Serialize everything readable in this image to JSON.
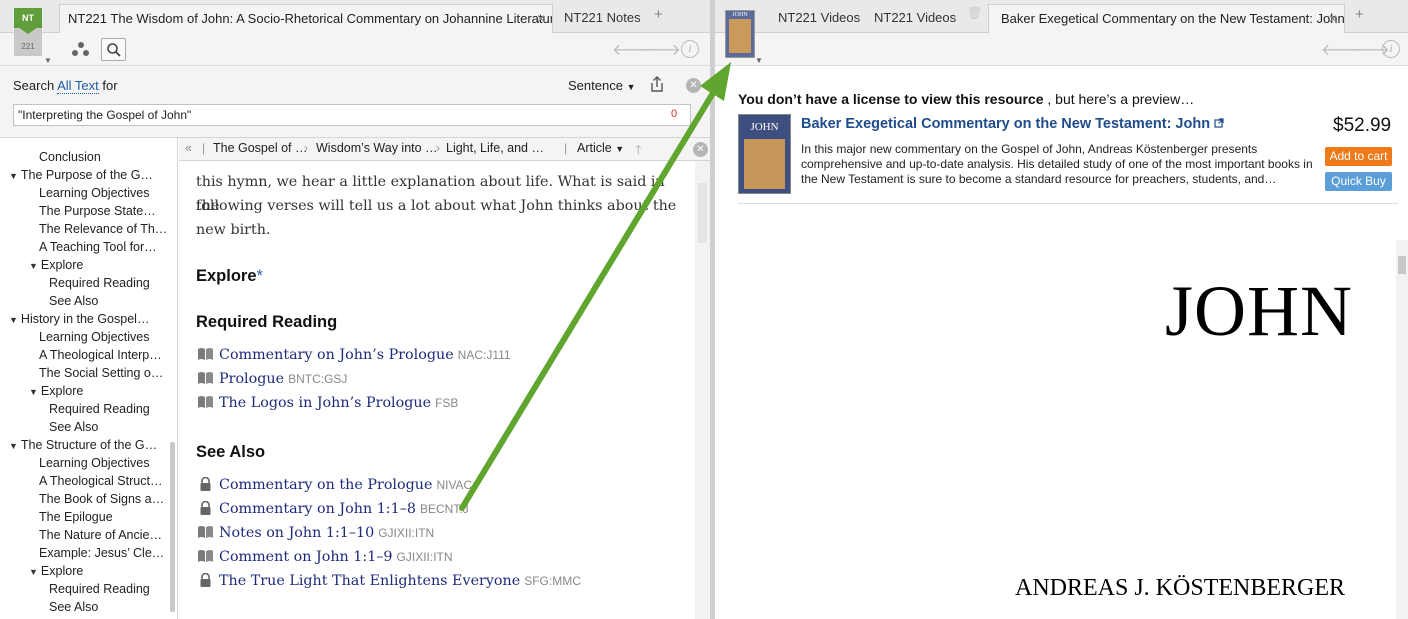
{
  "left": {
    "tabs": [
      {
        "label": "NT221 The Wisdom of John: A Socio-Rhetorical Commentary on Johannine Literature",
        "active": true
      },
      {
        "label": "NT221 Notes",
        "active": false
      }
    ],
    "logo": {
      "top": "NT",
      "bottom": "221"
    },
    "search": {
      "prefix": "Search",
      "scope": "All Text",
      "suffix": "for",
      "mode": "Sentence",
      "query": "\"Interpreting the Gospel of John\"",
      "count": "0"
    },
    "outline": [
      {
        "label": "Conclusion",
        "level": 2,
        "twisty": false
      },
      {
        "label": "The Purpose of the G…",
        "level": 1,
        "twisty": true
      },
      {
        "label": "Learning Objectives",
        "level": 2,
        "twisty": false
      },
      {
        "label": "The Purpose State…",
        "level": 2,
        "twisty": false
      },
      {
        "label": "The Relevance of Th…",
        "level": 2,
        "twisty": false
      },
      {
        "label": "A Teaching Tool for…",
        "level": 2,
        "twisty": false
      },
      {
        "label": "Explore",
        "level": 2,
        "twisty": true
      },
      {
        "label": "Required Reading",
        "level": 3,
        "twisty": false
      },
      {
        "label": "See Also",
        "level": 3,
        "twisty": false
      },
      {
        "label": "History in the Gospel…",
        "level": 1,
        "twisty": true
      },
      {
        "label": "Learning Objectives",
        "level": 2,
        "twisty": false
      },
      {
        "label": "A Theological Interp…",
        "level": 2,
        "twisty": false
      },
      {
        "label": "The Social Setting o…",
        "level": 2,
        "twisty": false
      },
      {
        "label": "Explore",
        "level": 2,
        "twisty": true
      },
      {
        "label": "Required Reading",
        "level": 3,
        "twisty": false
      },
      {
        "label": "See Also",
        "level": 3,
        "twisty": false
      },
      {
        "label": "The Structure of the G…",
        "level": 1,
        "twisty": true
      },
      {
        "label": "Learning Objectives",
        "level": 2,
        "twisty": false
      },
      {
        "label": "A Theological Struct…",
        "level": 2,
        "twisty": false
      },
      {
        "label": "The Book of Signs a…",
        "level": 2,
        "twisty": false
      },
      {
        "label": "The Epilogue",
        "level": 2,
        "twisty": false
      },
      {
        "label": "The Nature of Ancie…",
        "level": 2,
        "twisty": false
      },
      {
        "label": "Example: Jesus’ Cle…",
        "level": 2,
        "twisty": false
      },
      {
        "label": "Explore",
        "level": 2,
        "twisty": true
      },
      {
        "label": "Required Reading",
        "level": 3,
        "twisty": false
      },
      {
        "label": "See Also",
        "level": 3,
        "twisty": false
      }
    ],
    "breadcrumbs": [
      "The Gospel of …",
      "Wisdom’s Way into …",
      "Light, Life, and …"
    ],
    "article_label": "Article",
    "body_lines": [
      "this hymn, we hear a little explanation about life. What is said in the",
      "following verses will tell us a lot about what John thinks about the",
      "new birth."
    ],
    "explore_heading": "Explore",
    "explore_asterisk": "*",
    "required_heading": "Required Reading",
    "required": [
      {
        "title": "Commentary on John’s Prologue",
        "code": "NAC:J111",
        "locked": false
      },
      {
        "title": "Prologue",
        "code": "BNTC:GSJ",
        "locked": false
      },
      {
        "title": "The Logos in John’s Prologue",
        "code": "FSB",
        "locked": false
      }
    ],
    "seealso_heading": "See Also",
    "seealso": [
      {
        "title": "Commentary on the Prologue",
        "code": "NIVAC:",
        "locked": true
      },
      {
        "title": "Commentary on John 1:1–8",
        "code": "BECNT:J",
        "locked": true
      },
      {
        "title": "Notes on John 1:1–10",
        "code": "GJIXII:ITN",
        "locked": false
      },
      {
        "title": "Comment on John 1:1–9",
        "code": "GJIXII:ITN",
        "locked": false
      },
      {
        "title": "The True Light That Enlightens Everyone",
        "code": "SFG:MMC",
        "locked": true
      }
    ]
  },
  "right": {
    "tabs": [
      {
        "label": "NT221 Videos",
        "active": false
      },
      {
        "label": "NT221 Videos",
        "active": false
      },
      {
        "label": "Baker Exegetical Commentary on the New Testament: John",
        "active": true
      }
    ],
    "license_bold": "You don’t have a license to view this resource",
    "license_rest": ", but here’s a preview…",
    "product": {
      "cover_title": "JOHN",
      "title": "Baker Exegetical Commentary on the New Testament: John",
      "description": "In this major new commentary on the Gospel of John, Andreas Köstenberger presents comprehensive and up-to-date analysis. His detailed study of one of the most important books in the New Testament is sure to become a standard resource for preachers, students, and…",
      "price": "$52.99",
      "add_to_cart": "Add to cart",
      "quick_buy": "Quick Buy"
    },
    "preview_title": "JOHN",
    "preview_author": "ANDREAS J. KÖSTENBERGER"
  },
  "colors": {
    "accent_green": "#5fa52e",
    "link_blue": "#1f4d8c",
    "cart_orange": "#f07a1a",
    "buy_blue": "#5c9fd8"
  }
}
